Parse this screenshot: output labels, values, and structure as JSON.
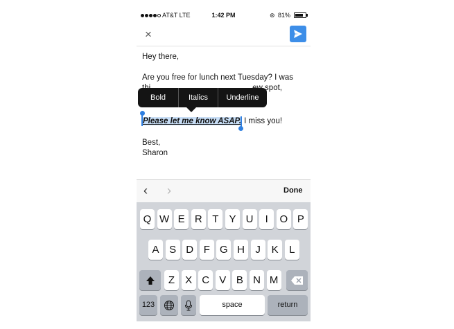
{
  "status_bar": {
    "carrier": "AT&T  LTE",
    "time": "1:42 PM",
    "battery_percent": "81%"
  },
  "header": {
    "close_icon": "×"
  },
  "email": {
    "greeting": "Hey there,",
    "para1_line1": "Are you free for lunch next Tuesday? I was",
    "para1_line2_visible": "thi",
    "para1_line2_tail": "ew spot,",
    "selected_text": "Please let me know ASAP.",
    "after_selection": " I miss you!",
    "signoff": "Best,",
    "signature": "Sharon"
  },
  "format_menu": {
    "bold": "Bold",
    "italics": "Italics",
    "underline": "Underline"
  },
  "accessory": {
    "prev": "‹",
    "next": "›",
    "done": "Done"
  },
  "keyboard": {
    "row1": [
      "Q",
      "W",
      "E",
      "R",
      "T",
      "Y",
      "U",
      "I",
      "O",
      "P"
    ],
    "row2": [
      "A",
      "S",
      "D",
      "F",
      "G",
      "H",
      "J",
      "K",
      "L"
    ],
    "row3": [
      "Z",
      "X",
      "C",
      "V",
      "B",
      "N",
      "M"
    ],
    "numbers": "123",
    "space": "space",
    "return": "return"
  },
  "colors": {
    "accent": "#3d8ee8",
    "selection": "#c7ddf5",
    "keyboard_bg": "#d1d4d9"
  }
}
